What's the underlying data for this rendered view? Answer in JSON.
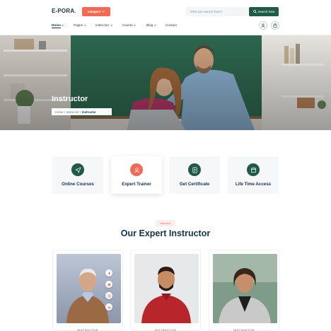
{
  "header": {
    "logo_text": "E-PORA",
    "logo_dot": ".",
    "category_label": "Categore",
    "search_placeholder": "What you want to learn?",
    "search_button": "Search Now"
  },
  "nav": {
    "items": [
      {
        "label": "Home"
      },
      {
        "label": "Pages"
      },
      {
        "label": "Instructor"
      },
      {
        "label": "Course"
      },
      {
        "label": "Blog"
      },
      {
        "label": "Contact"
      }
    ]
  },
  "hero": {
    "title": "Instructor",
    "breadcrumb": {
      "home": "Home",
      "sep1": "/",
      "parent": "Instructor",
      "sep2": "/",
      "current": "Instructor"
    }
  },
  "features": [
    {
      "label": "Online Courses",
      "icon": "send-icon",
      "color": "#1f5a47"
    },
    {
      "label": "Expert Trainer",
      "icon": "user-icon",
      "color": "#f16a55"
    },
    {
      "label": "Get Certificate",
      "icon": "certificate-icon",
      "color": "#1f5a47"
    },
    {
      "label": "Life Time Access",
      "icon": "calendar-icon",
      "color": "#1f5a47"
    }
  ],
  "section": {
    "badge": "Instructor",
    "title": "Our Expert Instructor"
  },
  "instructors": [
    {
      "role": "INSTRUCTOR"
    },
    {
      "role": "INSTRUCTOR"
    },
    {
      "role": "INSTRUCTOR"
    }
  ],
  "colors": {
    "accent": "#f16a55",
    "primary": "#1f5a47",
    "heading": "#16324a"
  }
}
